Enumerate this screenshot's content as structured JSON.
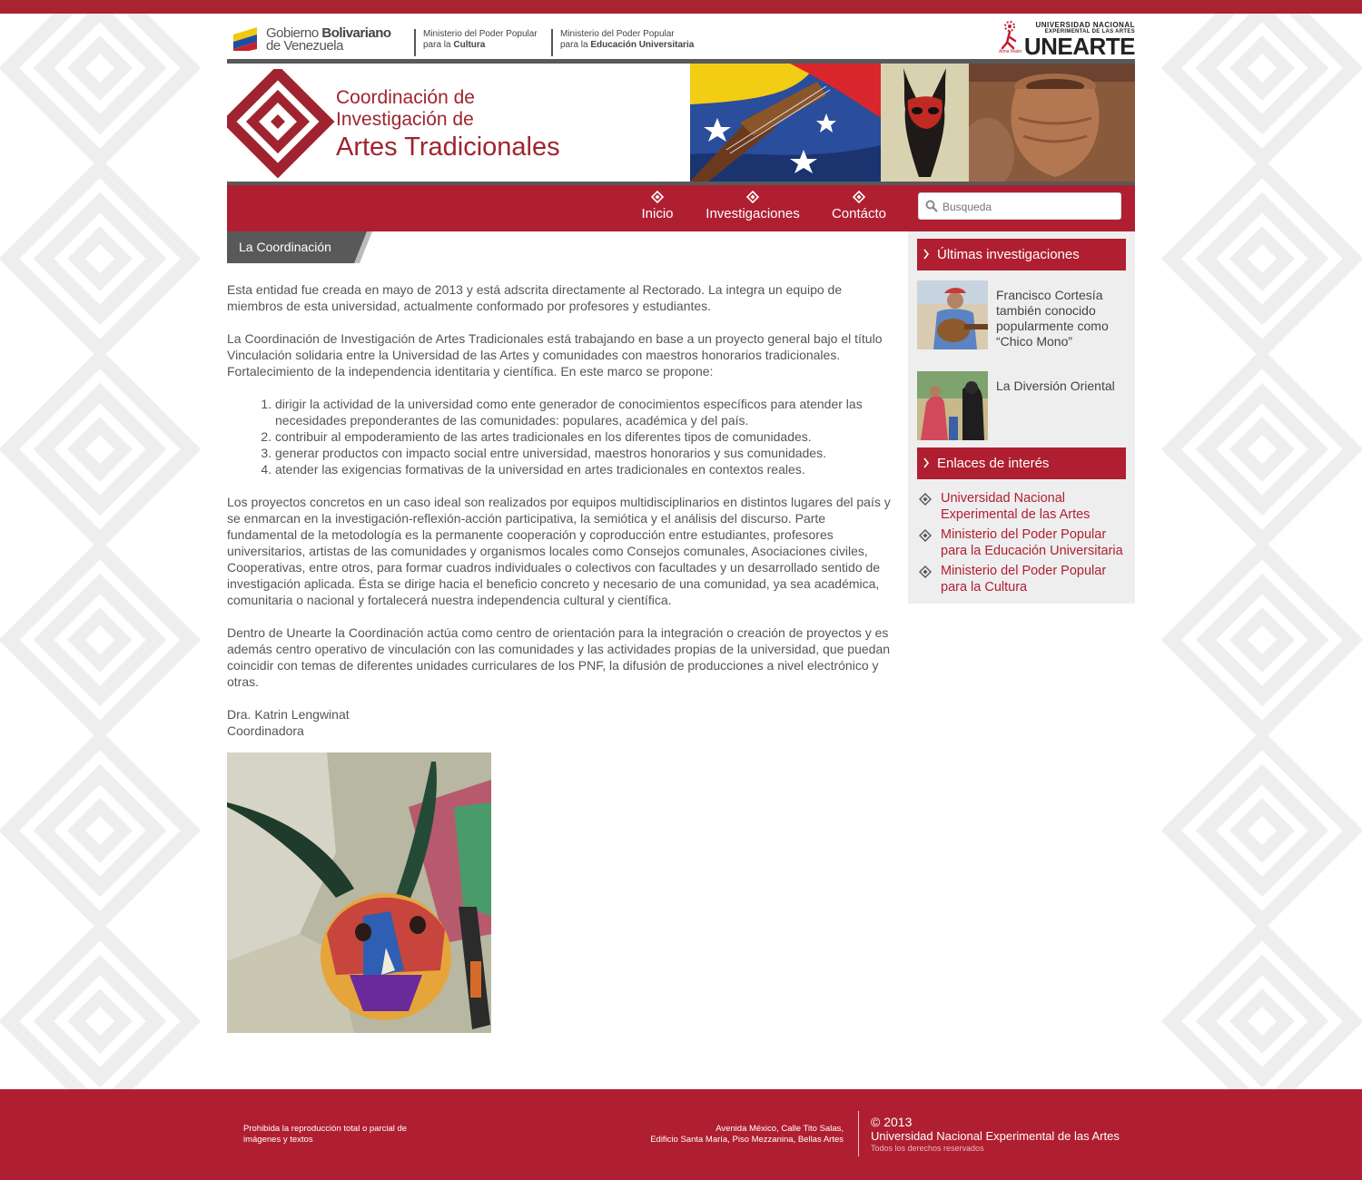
{
  "gov": {
    "name_line1_regular": "Gobierno ",
    "name_line1_bold": "Bolivariano",
    "name_line2": "de Venezuela",
    "ministry1_line1": "Ministerio del Poder Popular",
    "ministry1_line2_prefix": "para la ",
    "ministry1_line2_bold": "Cultura",
    "ministry2_line1": "Ministerio del Poder Popular",
    "ministry2_line2_prefix": "para la ",
    "ministry2_line2_bold": "Educación Universitaria"
  },
  "university_logo": {
    "line1": "UNIVERSIDAD NACIONAL",
    "line2": "EXPERIMENTAL DE LAS ARTES",
    "line3": "UNEARTE",
    "tagline": "Alma Mater"
  },
  "banner": {
    "line1": "Coordinación de",
    "line2": "Investigación de",
    "line3": "Artes Tradicionales"
  },
  "nav": {
    "items": [
      {
        "label": "Inicio",
        "icon": "diamond-icon"
      },
      {
        "label": "Investigaciones",
        "icon": "diamond-icon"
      },
      {
        "label": "Contácto",
        "icon": "diamond-icon"
      }
    ],
    "search_placeholder": "Busqueda"
  },
  "main": {
    "section_title": "La Coordinación",
    "p1": "Esta entidad fue creada en mayo de 2013 y está adscrita directamente al Rectorado. La integra un equipo de miembros de esta universidad, actualmente conformado por profesores y estudiantes.",
    "p2": "La Coordinación de Investigación de Artes Tradicionales está trabajando en base a un proyecto general bajo el título Vinculación solidaria entre la Universidad de las Artes y comunidades con maestros honorarios tradicio­nales. Fortalecimiento de la independencia identitaria y científica. En este marco se propone:",
    "list": [
      "dirigir la actividad de la universidad como ente generador de conocimientos específicos para atender las necesidades preponderantes de las comunidades: populares, académica y del país.",
      "contribuir al empoderamiento de las artes tradicionales en los diferentes tipos de comunidades.",
      "generar productos con impacto social entre universidad, maestros honorarios y sus comunidades.",
      "atender las exigencias formativas de la universidad en artes tradicionales en contextos reales."
    ],
    "p3": "Los proyectos concretos en un caso ideal son realizados por equipos multidisciplinarios  en distintos lugares del país y se enmarcan en la investigación-reflexión-acción participativa, la semiótica y el análisis del discurso. Parte fundamental de la metodología es la permanente cooperación y coproducción entre estudiantes, profeso­res universitarios, artistas de las comunidades y organismos locales como Consejos comunales, Asociaciones civiles, Cooperativas, entre otros, para formar cuadros individuales o colectivos con facultades y un desarrolla­do sentido de investigación aplicada. Ésta se dirige hacia el beneficio concreto y necesario de una comunidad, ya sea académica, comunitaria o nacional y fortalecerá nuestra independencia cultural y científica.",
    "p4": "Dentro de Unearte la Coordinación actúa como centro de orientación para la integración o creación de proyec­tos y es además centro operativo de vinculación con las comunidades y las actividades propias de la universi­dad, que puedan  coincidir con temas de diferentes unidades curriculares de los PNF, la difusión de produccio­nes a nivel electrónico y otras.",
    "signature_name": "Dra. Katrin Lengwinat",
    "signature_role": "Coordinadora"
  },
  "sidebar": {
    "research_title": "Últimas investigaciones",
    "research_items": [
      {
        "title": "Francisco Cortesía también conocido popularmente como “Chico Mono”"
      },
      {
        "title": "La Diversión Oriental"
      }
    ],
    "links_title": "Enlaces de interés",
    "links": [
      {
        "label": "Universidad Nacional Experimental de las Artes"
      },
      {
        "label": "Ministerio del Poder Popular para la Educación Universitaria"
      },
      {
        "label": "Ministerio del Poder Popular para la Cultura"
      }
    ]
  },
  "footer": {
    "rights_notice": "Prohibida la reproducción total o parcial de imágenes y textos",
    "address_line1": "Avenida México, Calle Tito Salas,",
    "address_line2": "Edificio Santa María, Piso Mezzanina, Bellas Artes",
    "copyright": "© 2013",
    "university": "Universidad Nacional Experimental de las Artes",
    "all_rights": "Todos los derechos reservados"
  },
  "colors": {
    "brand_red": "#b01f31",
    "dark_gray": "#595959",
    "sidebar_bg": "#eeeeee"
  }
}
